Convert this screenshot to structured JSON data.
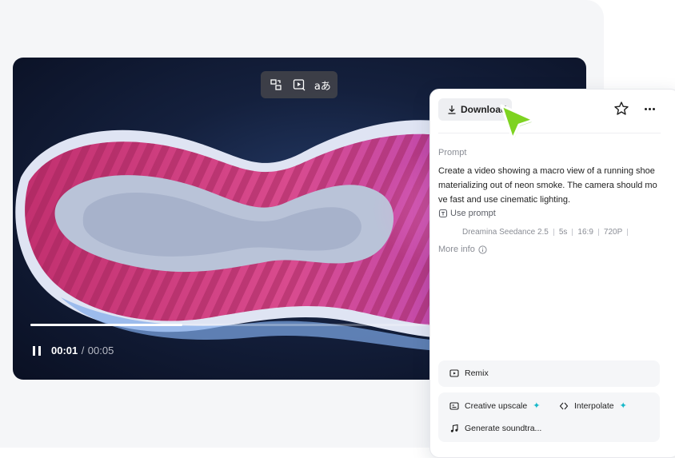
{
  "player": {
    "current_time": "00:01",
    "time_separator": "/",
    "total_time": "00:05",
    "progress": 0.28,
    "toolbar_icons": [
      "swap-icon",
      "play-preview-icon",
      "translate-icon"
    ],
    "translate_glyph": "aあ"
  },
  "panel": {
    "download_label": "Download",
    "prompt_heading": "Prompt",
    "prompt_text": "Create a video showing a macro view of a running shoe materializing out of neon smoke. The camera should move fast and use cinematic lighting.",
    "use_prompt_label": "Use prompt",
    "meta": [
      "Dreamina Seedance 2.5",
      "5s",
      "16:9",
      "720P"
    ],
    "more_info_label": "More info",
    "remix_label": "Remix",
    "creative_upscale_label": "Creative upscale",
    "interpolate_label": "Interpolate",
    "generate_soundtrack_label": "Generate soundtra..."
  },
  "colors": {
    "accent_spark": "#17b8c9",
    "cursor_green": "#7ed321"
  }
}
